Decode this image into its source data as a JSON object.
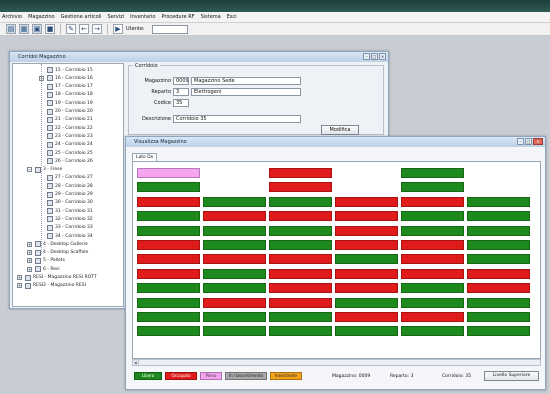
{
  "menubar": {
    "items": [
      "Archivio",
      "Magazzino",
      "Gestione articoli",
      "Servizi",
      "Inventario",
      "Procedure RF",
      "Sistema",
      "Esci"
    ]
  },
  "toolbar": {
    "user_label": "Utente:",
    "user_value": "",
    "buttons": [
      {
        "name": "new-icon",
        "glyph": "▤"
      },
      {
        "name": "grid-icon",
        "glyph": "▦"
      },
      {
        "name": "form-icon",
        "glyph": "▣"
      },
      {
        "name": "save-icon",
        "glyph": "■"
      },
      {
        "name": "tools-icon",
        "glyph": "✎"
      },
      {
        "name": "back-icon",
        "glyph": "←"
      },
      {
        "name": "forward-icon",
        "glyph": "→"
      },
      {
        "name": "run-icon",
        "glyph": "▶"
      }
    ]
  },
  "tree_window": {
    "title": "Corridoi Magazzino",
    "nodes": [
      {
        "label": "15 - Corridoio 15",
        "level": 2
      },
      {
        "label": "16 - Corridoio 16",
        "level": 2,
        "expandable": true
      },
      {
        "label": "17 - Corridoio 17",
        "level": 2
      },
      {
        "label": "18 - Corridoio 18",
        "level": 2
      },
      {
        "label": "19 - Corridoio 19",
        "level": 2
      },
      {
        "label": "20 - Corridoio 20",
        "level": 2
      },
      {
        "label": "21 - Corridoio 21",
        "level": 2
      },
      {
        "label": "22 - Corridoio 22",
        "level": 2
      },
      {
        "label": "23 - Corridoio 23",
        "level": 2
      },
      {
        "label": "24 - Corridoio 24",
        "level": 2
      },
      {
        "label": "25 - Corridoio 25",
        "level": 2
      },
      {
        "label": "26 - Corridoio 26",
        "level": 2
      },
      {
        "label": "3 - Frese",
        "level": 1,
        "expandable": true
      },
      {
        "label": "27 - Corridoio 27",
        "level": 2
      },
      {
        "label": "28 - Corridoio 28",
        "level": 2
      },
      {
        "label": "29 - Corridoio 29",
        "level": 2
      },
      {
        "label": "30 - Corridoio 30",
        "level": 2
      },
      {
        "label": "31 - Corridoio 31",
        "level": 2
      },
      {
        "label": "32 - Corridoio 32",
        "level": 2
      },
      {
        "label": "33 - Corridoio 33",
        "level": 2
      },
      {
        "label": "34 - Corridoio 34",
        "level": 2
      },
      {
        "label": "4 - Desktop Gallerie",
        "level": 1,
        "expandable": true
      },
      {
        "label": "4 - Desktop Scaffale",
        "level": 1,
        "expandable": true
      },
      {
        "label": "5 - Pallets",
        "level": 1,
        "expandable": true
      },
      {
        "label": "6 - Resi",
        "level": 1,
        "expandable": true
      },
      {
        "label": "RESI - Magazzino RESI ROTT",
        "level": 0,
        "expandable": true
      },
      {
        "label": "RESI2 - Magazzino RESI",
        "level": 0,
        "expandable": true
      }
    ],
    "details": {
      "group_title": "Corridoio",
      "fields": [
        {
          "label": "Magazzino",
          "code": "0009",
          "desc": "Magazzino Sede"
        },
        {
          "label": "Reparto",
          "code": "3",
          "desc": "Elettrogeni"
        },
        {
          "label": "Codice",
          "code": "35",
          "desc": ""
        },
        {
          "label": "Descrizione",
          "code": "",
          "desc": "Corridoio 35"
        }
      ],
      "modify_label": "Modifica"
    }
  },
  "grid_window": {
    "title": "Visualizza Magazzino",
    "tab_label": "Lato Dx",
    "colors": {
      "green": "#1e8a1e",
      "red": "#e01b1b",
      "pink": "#f6a3f2",
      "gray": "#a8a8a8",
      "orange": "#f3a21c"
    },
    "grid": [
      [
        "pink",
        "",
        "red",
        "",
        "green",
        ""
      ],
      [
        "green",
        "",
        "red",
        "",
        "green",
        ""
      ],
      [
        "red",
        "green",
        "green",
        "red",
        "red",
        "green"
      ],
      [
        "green",
        "red",
        "red",
        "red",
        "green",
        "green"
      ],
      [
        "green",
        "green",
        "green",
        "red",
        "green",
        "green"
      ],
      [
        "red",
        "green",
        "green",
        "red",
        "red",
        "green"
      ],
      [
        "red",
        "red",
        "red",
        "green",
        "red",
        "green"
      ],
      [
        "red",
        "green",
        "red",
        "red",
        "red",
        "red"
      ],
      [
        "green",
        "green",
        "red",
        "red",
        "green",
        "red"
      ],
      [
        "green",
        "red",
        "red",
        "green",
        "green",
        "green"
      ],
      [
        "green",
        "green",
        "green",
        "red",
        "red",
        "green"
      ],
      [
        "green",
        "green",
        "green",
        "green",
        "green",
        "green"
      ]
    ],
    "cell_labels": [
      [
        "",
        "",
        "",
        "",
        "",
        ""
      ],
      [
        "",
        "",
        "",
        "",
        "",
        ""
      ],
      [
        "",
        "",
        "",
        "",
        "",
        ""
      ],
      [
        "",
        "",
        "",
        "",
        "",
        ""
      ],
      [
        "",
        "",
        "",
        "",
        "",
        ""
      ],
      [
        "",
        "",
        "",
        "",
        "",
        ""
      ],
      [
        "",
        "",
        "",
        "",
        "",
        ""
      ],
      [
        "",
        "",
        "",
        "",
        "",
        ""
      ],
      [
        "",
        "",
        "",
        "",
        "",
        ""
      ],
      [
        "",
        "",
        "",
        "",
        "",
        ""
      ],
      [
        "",
        "",
        "",
        "",
        "",
        ""
      ],
      [
        "",
        "",
        "",
        "",
        "",
        ""
      ]
    ],
    "legend": [
      {
        "label": "Libero",
        "color": "green",
        "text_color": "#ffffff"
      },
      {
        "label": "Occupato",
        "color": "red",
        "text_color": "#ffffff"
      },
      {
        "label": "Pieno",
        "color": "pink",
        "text_color": "#333333"
      },
      {
        "label": "In riassortimento",
        "color": "gray",
        "text_color": "#222222"
      },
      {
        "label": "Inesistente",
        "color": "orange",
        "text_color": "#222222"
      }
    ],
    "status": {
      "magazzino": "Magazzino: 0009",
      "reparto": "Reparto: 3",
      "corridoio": "Corridoio: 35"
    },
    "corridor_view_label": "Livello Superiore"
  }
}
